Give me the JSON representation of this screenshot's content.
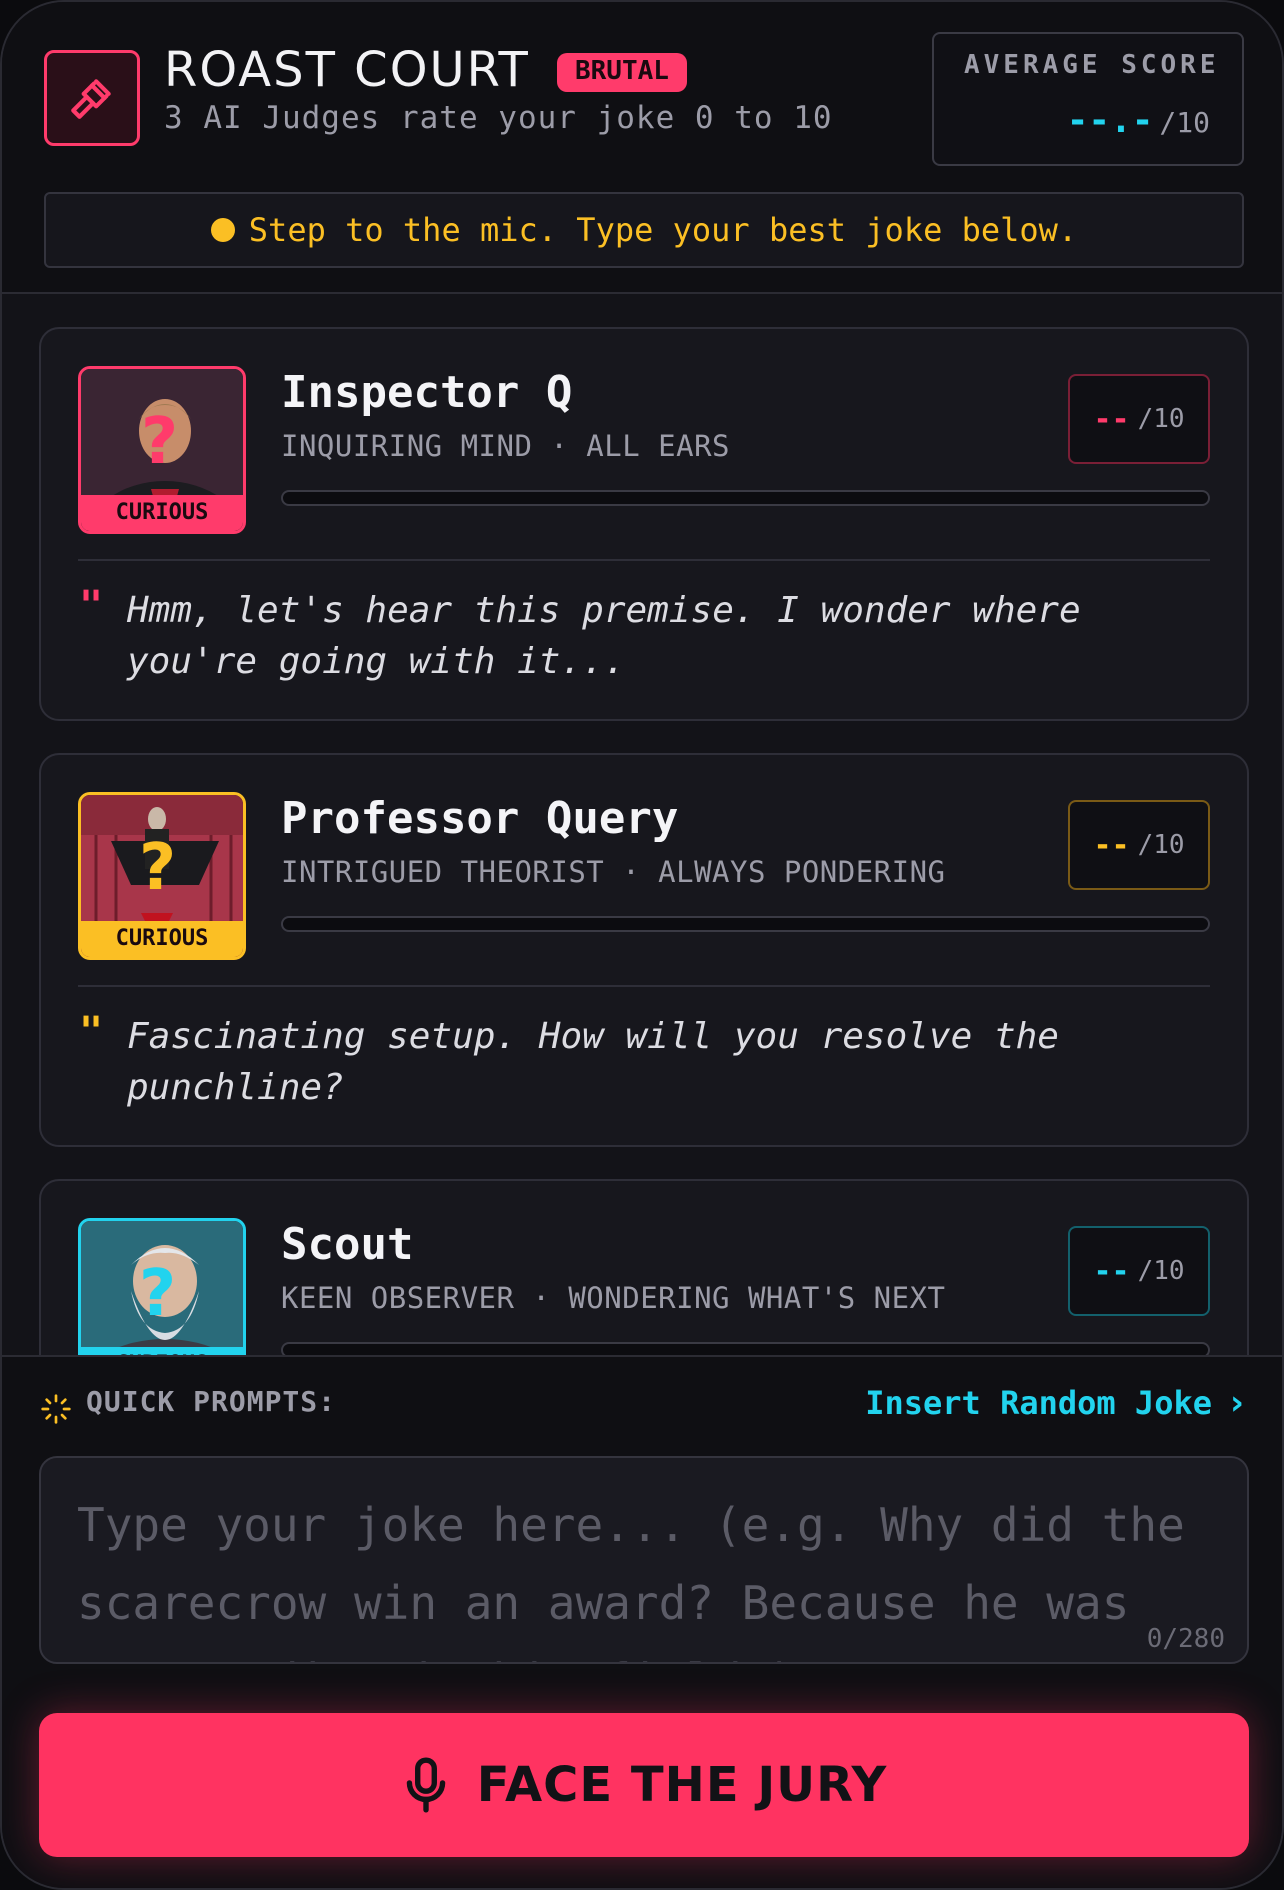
{
  "header": {
    "title": "ROAST COURT",
    "badge": "BRUTAL",
    "subtitle": "3 AI Judges rate your joke 0 to 10",
    "logo_icon": "gavel-icon",
    "average": {
      "label": "AVERAGE SCORE",
      "value": "--.-",
      "denominator": "/10"
    }
  },
  "status": {
    "text": "Step to the mic. Type your best joke below."
  },
  "judges": [
    {
      "name": "Inspector Q",
      "subtitle": "INQUIRING MIND · ALL EARS",
      "mood": "CURIOUS",
      "score": "--",
      "denominator": "/10",
      "quote": "Hmm, let's hear this premise. I wonder where you're going with it...",
      "color": "#ff3b6b",
      "progress": 0
    },
    {
      "name": "Professor Query",
      "subtitle": "INTRIGUED THEORIST · ALWAYS PONDERING",
      "mood": "CURIOUS",
      "score": "--",
      "denominator": "/10",
      "quote": "Fascinating setup. How will you resolve the punchline?",
      "color": "#fbbf24",
      "progress": 0
    },
    {
      "name": "Scout",
      "subtitle": "KEEN OBSERVER · WONDERING WHAT'S NEXT",
      "mood": "CURIOUS",
      "score": "--",
      "denominator": "/10",
      "color": "#22d3ee",
      "progress": 0
    }
  ],
  "prompts": {
    "label": "QUICK PROMPTS:",
    "random_link": "Insert Random Joke",
    "placeholder": "Type your joke here... (e.g. Why did the scarecrow win an award? Because he was outstanding in his field.)",
    "counter": "0/280"
  },
  "cta": {
    "label": "FACE THE JURY",
    "icon": "microphone-icon"
  }
}
